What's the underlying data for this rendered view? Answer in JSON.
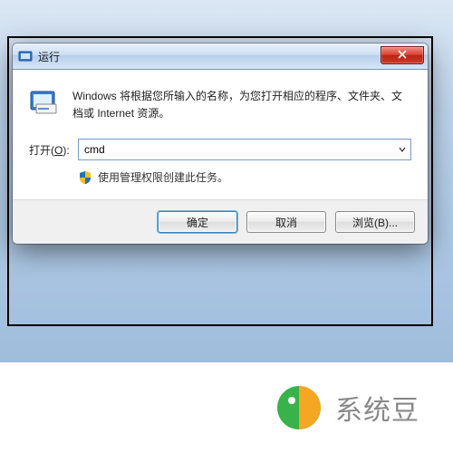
{
  "window": {
    "title": "运行"
  },
  "body": {
    "description": "Windows 将根据您所输入的名称，为您打开相应的程序、文件夹、文档或 Internet 资源。",
    "open_label_prefix": "打开(",
    "open_label_key": "O",
    "open_label_suffix": "):",
    "input_value": "cmd",
    "admin_note": "使用管理权限创建此任务。"
  },
  "buttons": {
    "ok": "确定",
    "cancel": "取消",
    "browse": "浏览(B)..."
  },
  "watermark": {
    "text": "系统豆"
  },
  "colors": {
    "close_red": "#c8372a",
    "aero_border": "#7a9ecb",
    "shield_blue": "#2b6fb5",
    "shield_yellow": "#f5c21b",
    "logo_green": "#39b24a",
    "logo_orange": "#f5a623"
  }
}
